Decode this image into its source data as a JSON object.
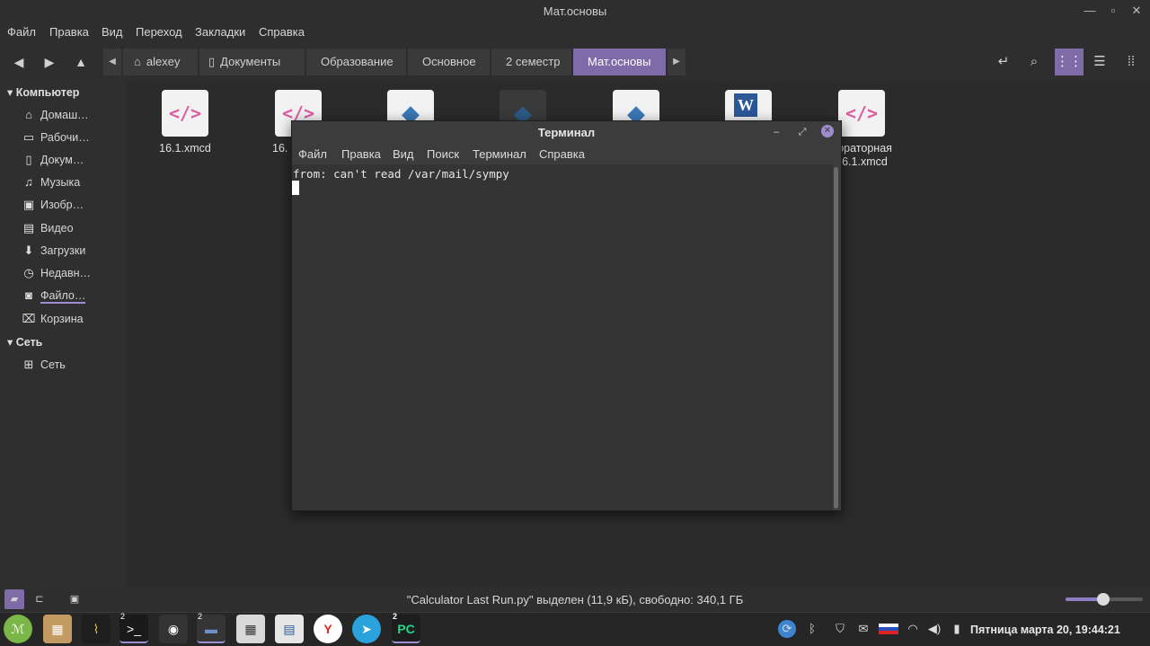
{
  "window": {
    "title": "Мат.основы"
  },
  "menu": [
    "Файл",
    "Правка",
    "Вид",
    "Переход",
    "Закладки",
    "Справка"
  ],
  "breadcrumbs": [
    "alexey",
    "Документы",
    "Образование",
    "Основное",
    "2 семестр",
    "Мат.основы"
  ],
  "sidebar": {
    "computer_header": "Компьютер",
    "items": [
      {
        "label": "Домаш…",
        "icon": "home-icon"
      },
      {
        "label": "Рабочи…",
        "icon": "desktop-icon"
      },
      {
        "label": "Докум…",
        "icon": "documents-icon"
      },
      {
        "label": "Музыка",
        "icon": "music-icon"
      },
      {
        "label": "Изобр…",
        "icon": "pictures-icon"
      },
      {
        "label": "Видео",
        "icon": "video-icon"
      },
      {
        "label": "Загрузки",
        "icon": "downloads-icon"
      },
      {
        "label": "Недавн…",
        "icon": "recent-icon"
      },
      {
        "label": "Файло…",
        "icon": "filesystem-icon"
      },
      {
        "label": "Корзина",
        "icon": "trash-icon"
      }
    ],
    "network_header": "Сеть",
    "network_items": [
      {
        "label": "Сеть",
        "icon": "network-icon"
      }
    ]
  },
  "files": [
    {
      "name": "16.1.xmcd",
      "type": "xmcd"
    },
    {
      "name": "16.",
      "type": "xmcd"
    },
    {
      "name": "",
      "type": "python"
    },
    {
      "name": "",
      "type": "python-dark"
    },
    {
      "name": "",
      "type": "python"
    },
    {
      "name": "",
      "type": "word"
    },
    {
      "name": "бораторная\n16.1.xmcd",
      "type": "xmcd"
    }
  ],
  "status": {
    "text": "\"Calculator Last Run.py\" выделен (11,9 кБ), свободно: 340,1 ГБ",
    "zoom_fraction": 0.5
  },
  "terminal": {
    "title": "Терминал",
    "menu": [
      "Файл",
      "Правка",
      "Вид",
      "Поиск",
      "Терминал",
      "Справка"
    ],
    "output": "from: can't read /var/mail/sympy"
  },
  "taskbar": {
    "clock": "Пятница марта 20, 19:44:21",
    "badges": {
      "terminal": "2",
      "files": "2",
      "pycharm": "2"
    }
  },
  "colors": {
    "accent": "#7e6ba8",
    "accent_light": "#9f8dd0",
    "bg": "#2b2b2b"
  }
}
